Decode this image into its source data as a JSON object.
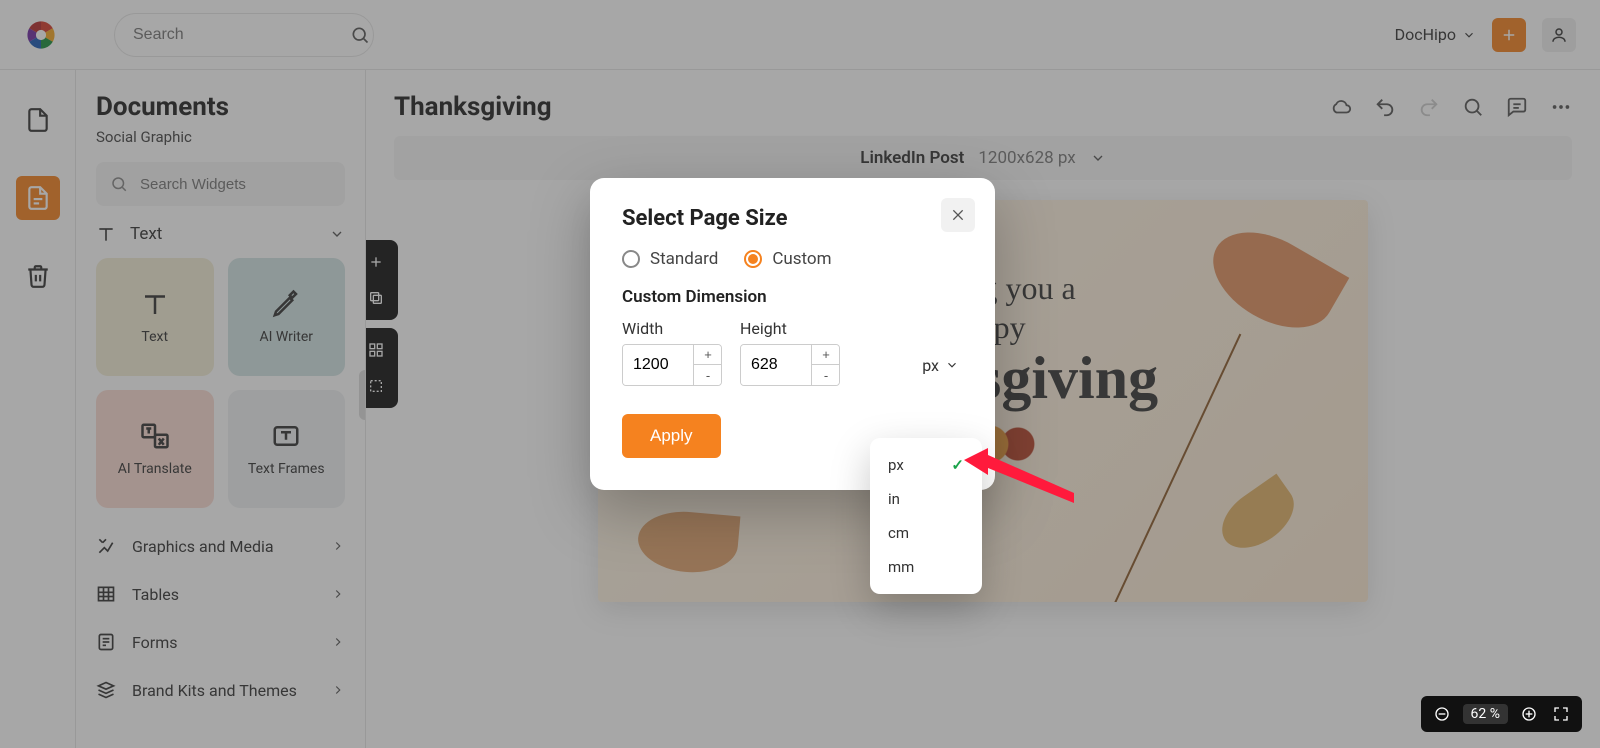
{
  "topbar": {
    "search_placeholder": "Search",
    "user_label": "DocHipo"
  },
  "rail": {},
  "sidebar": {
    "title": "Documents",
    "subtitle": "Social Graphic",
    "widget_search_placeholder": "Search Widgets",
    "section_text": "Text",
    "tiles": {
      "text": "Text",
      "ai_writer": "AI Writer",
      "ai_translate": "AI Translate",
      "text_frames": "Text Frames"
    },
    "items": {
      "graphics": "Graphics and Media",
      "tables": "Tables",
      "forms": "Forms",
      "brand": "Brand Kits and Themes"
    }
  },
  "main": {
    "title": "Thanksgiving",
    "size_label": "LinkedIn Post",
    "size_dims": "1200x628 px"
  },
  "canvas": {
    "line1": "Wishing you a",
    "line2": "Happy",
    "line3": "Thanksgiving"
  },
  "modal": {
    "title": "Select Page Size",
    "option_standard": "Standard",
    "option_custom": "Custom",
    "custom_label": "Custom Dimension",
    "width_label": "Width",
    "height_label": "Height",
    "width_value": "1200",
    "height_value": "628",
    "unit_label": "px",
    "apply": "Apply"
  },
  "unit_dropdown": {
    "options": [
      "px",
      "in",
      "cm",
      "mm"
    ],
    "selected": "px"
  },
  "zoom": {
    "level": "62 %"
  }
}
